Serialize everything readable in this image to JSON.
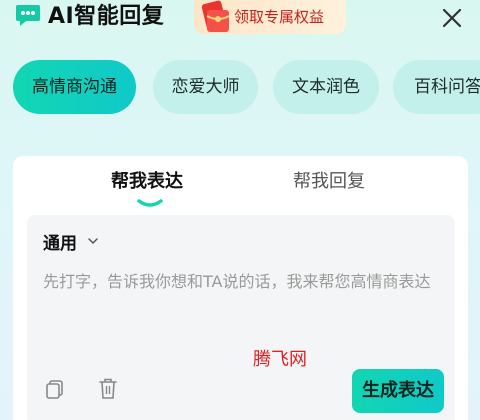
{
  "header": {
    "title": "AI智能回复",
    "promo_label": "领取专属权益"
  },
  "categories": [
    {
      "label": "高情商沟通",
      "active": true
    },
    {
      "label": "恋爱大师",
      "active": false
    },
    {
      "label": "文本润色",
      "active": false
    },
    {
      "label": "百科问答",
      "active": false
    }
  ],
  "tabs": [
    {
      "label": "帮我表达",
      "active": true
    },
    {
      "label": "帮我回复",
      "active": false
    }
  ],
  "editor": {
    "mode": "通用",
    "placeholder": "先打字，告诉我你想和TA说的话，我来帮您高情商表达",
    "watermark": "腾飞网",
    "generate_label": "生成表达"
  },
  "colors": {
    "accent": "#12d6b2",
    "chip_inactive": "#c3f0ea",
    "promo_text": "#c6221b",
    "watermark": "#e02020"
  },
  "icons": [
    "chat-bubble-logo-icon",
    "red-packet-icon",
    "close-icon",
    "chevron-down-icon",
    "copy-icon",
    "trash-icon"
  ]
}
